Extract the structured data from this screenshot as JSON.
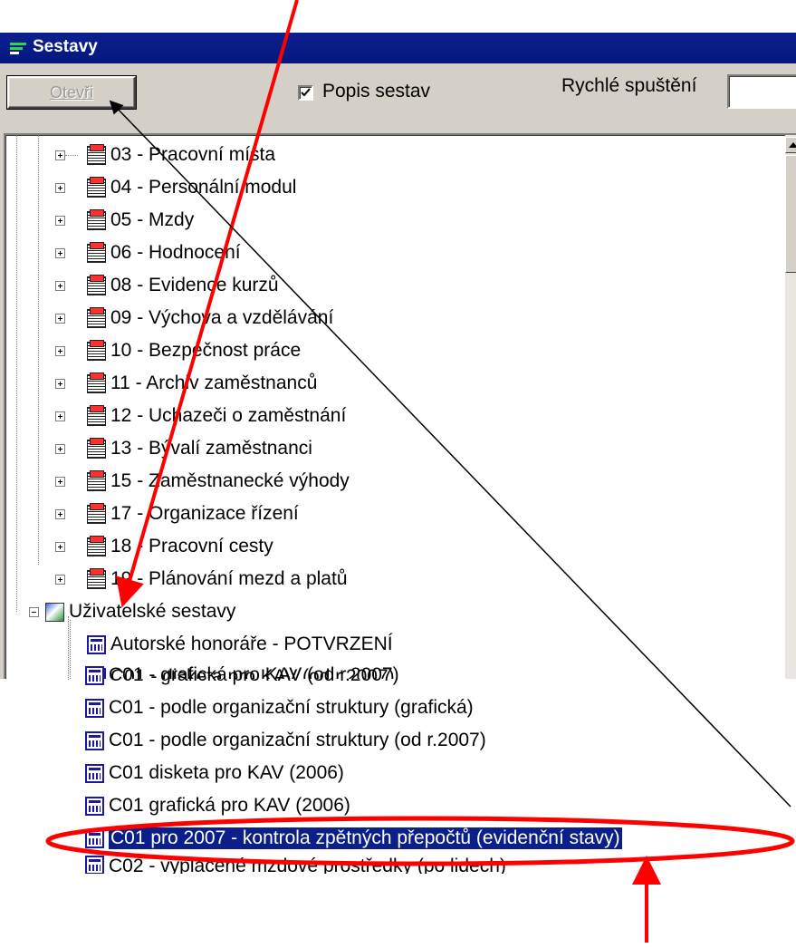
{
  "window": {
    "title": "Sestavy",
    "colors": {
      "titlebar": "#0c1f8e",
      "selection": "#0a1f8a",
      "annotation": "#ff0000"
    }
  },
  "toolbar": {
    "open_label": "Otevři",
    "checkbox_label": "Popis sestav",
    "checkbox_checked": true,
    "quick_label": "Rychlé spuštění",
    "quick_value": ""
  },
  "tree": {
    "modules": [
      {
        "label": "03 - Pracovní místa"
      },
      {
        "label": "04 - Personální modul"
      },
      {
        "label": "05 - Mzdy"
      },
      {
        "label": "06 - Hodnocení"
      },
      {
        "label": "08 - Evidence kurzů"
      },
      {
        "label": "09 - Výchova a vzdělávání"
      },
      {
        "label": "10 - Bezpečnost práce"
      },
      {
        "label": "11 - Archiv zaměstnanců"
      },
      {
        "label": "12 - Uchazeči o zaměstnání"
      },
      {
        "label": "13 - Bývalí zaměstnanci"
      },
      {
        "label": "15 - Zaměstnanecké výhody"
      },
      {
        "label": "17 - Organizace řízení"
      },
      {
        "label": "18 - Pracovní cesty"
      },
      {
        "label": "19 - Plánování mezd a platů"
      }
    ],
    "user_group": {
      "label": "Uživatelské sestavy"
    },
    "reports": [
      {
        "label": "Autorské honoráře  - POTVRZENÍ"
      },
      {
        "label": "C01 - disketa pro KAV (od r.2007)"
      },
      {
        "label": "C01 - grafická pro KAV (od r.2007)"
      },
      {
        "label": "C01 - podle organizační struktury (grafická)"
      },
      {
        "label": "C01 - podle organizační struktury (od r.2007)"
      },
      {
        "label": "C01 disketa pro KAV (2006)"
      },
      {
        "label": "C01 grafická pro KAV (2006)"
      },
      {
        "label": "C01 pro 2007 - kontrola zpětných přepočtů (evidenční stavy)"
      },
      {
        "label": "C02 - vyplacené mzdové prostředky (po lidech)"
      }
    ],
    "selected_report": "C01 pro 2007 - kontrola zpětných přepočtů (evidenční stavy)"
  }
}
